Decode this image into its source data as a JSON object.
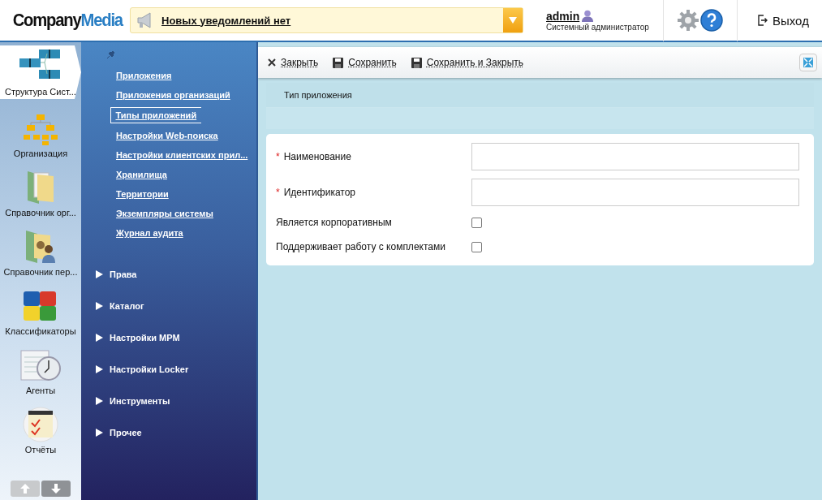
{
  "header": {
    "logo": {
      "first": "Company",
      "second": "Media"
    },
    "notification": "Новых уведомлений нет",
    "user": {
      "name": "admin",
      "role": "Системный администратор"
    },
    "logout": "Выход"
  },
  "rail": {
    "items": [
      {
        "label": "Структура Сист...",
        "selected": true
      },
      {
        "label": "Организация",
        "selected": false
      },
      {
        "label": "Справочник орг...",
        "selected": false
      },
      {
        "label": "Справочник пер...",
        "selected": false
      },
      {
        "label": "Классификаторы",
        "selected": false
      },
      {
        "label": "Агенты",
        "selected": false
      },
      {
        "label": "Отчёты",
        "selected": false
      }
    ]
  },
  "nav": {
    "links": [
      {
        "label": "Приложения",
        "selected": false
      },
      {
        "label": "Приложения организаций",
        "selected": false
      },
      {
        "label": "Типы приложений",
        "selected": true
      },
      {
        "label": "Настройки Web-поиска",
        "selected": false
      },
      {
        "label": "Настройки клиентских прил...",
        "selected": false
      },
      {
        "label": "Хранилища",
        "selected": false
      },
      {
        "label": "Территории",
        "selected": false
      },
      {
        "label": "Экземпляры системы",
        "selected": false
      },
      {
        "label": "Журнал аудита",
        "selected": false
      }
    ],
    "groups": [
      {
        "label": "Права",
        "expanded": false
      },
      {
        "label": "Каталог",
        "expanded": false
      },
      {
        "label": "Настройки МРМ",
        "expanded": false
      },
      {
        "label": "Настройки Locker",
        "expanded": false
      },
      {
        "label": "Инструменты",
        "expanded": false
      },
      {
        "label": "Прочее",
        "expanded": false
      }
    ]
  },
  "toolbar": [
    {
      "label": "Закрыть"
    },
    {
      "label": "Сохранить"
    },
    {
      "label": "Сохранить и Закрыть"
    }
  ],
  "form": {
    "title": "Тип приложения",
    "fields": [
      {
        "kind": "text",
        "label": "Наименование",
        "marker": "*"
      },
      {
        "kind": "text",
        "label": "Идентификатор",
        "marker": "*"
      },
      {
        "kind": "checkbox",
        "label": "Является корпоративным",
        "checked": false
      },
      {
        "kind": "checkbox",
        "label": "Поддерживает работу с комплектами",
        "checked": false
      }
    ]
  }
}
